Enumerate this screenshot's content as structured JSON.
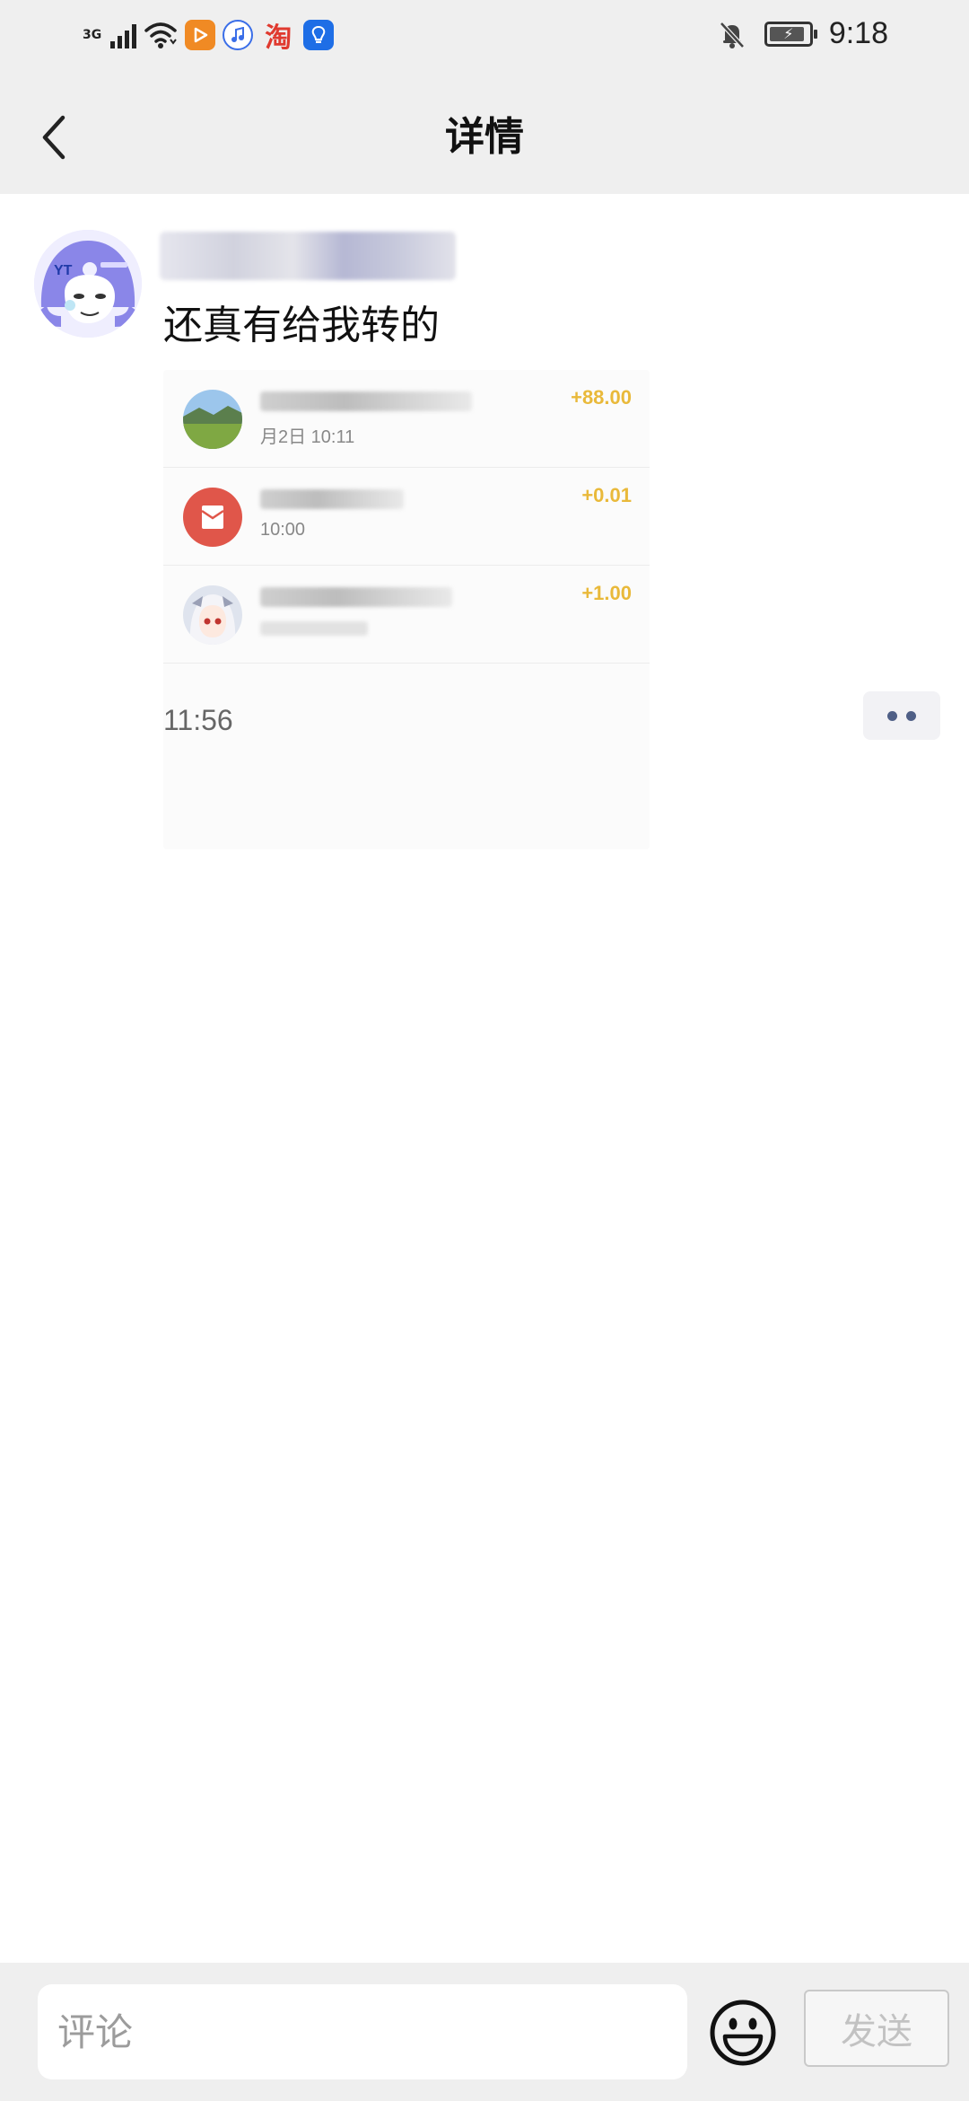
{
  "status_bar": {
    "network_type": "3G",
    "time": "9:18",
    "app_icons": [
      "video-app-icon",
      "music-app-icon",
      "taobao-app-icon",
      "bulb-app-icon"
    ],
    "taobao_glyph": "淘",
    "icons": [
      "signal-icon",
      "wifi-icon",
      "bell-off-icon",
      "battery-charging-icon"
    ]
  },
  "header": {
    "title": "详情",
    "back_icon": "chevron-left-icon"
  },
  "post": {
    "text": "还真有给我转的",
    "time": "11:56",
    "more_icon": "more-dots-icon",
    "transfers": [
      {
        "amount": "+88.00",
        "subtitle": "月2日 10:11",
        "avatar": "landscape-avatar-icon"
      },
      {
        "amount": "+0.01",
        "subtitle": "10:00",
        "avatar": "red-envelope-icon"
      },
      {
        "amount": "+1.00",
        "subtitle": "",
        "avatar": "anime-avatar-icon"
      }
    ]
  },
  "comment_bar": {
    "placeholder": "评论",
    "send_label": "发送",
    "emoji_icon": "smiley-icon"
  },
  "colors": {
    "status_bar_bg": "#efefef",
    "amount": "#e9b93a",
    "more_dot": "#4f5f86",
    "red_envelope": "#e0564a",
    "avatar_bg": "#8a86e8"
  }
}
